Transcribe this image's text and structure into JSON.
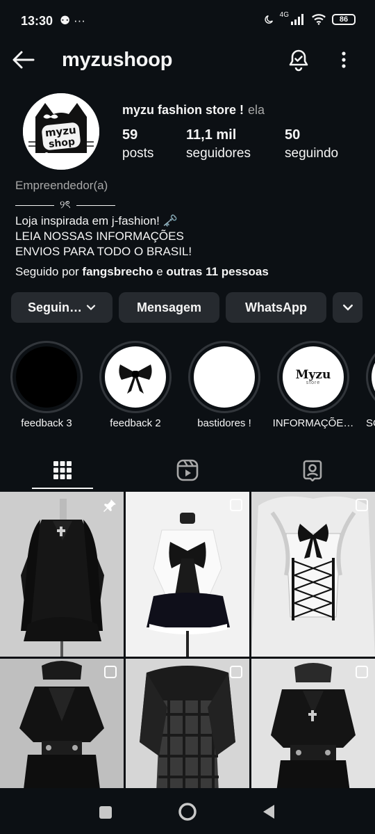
{
  "status_bar": {
    "time": "13:30",
    "left_icons": "⚉ ···",
    "network": "4G",
    "battery": "86"
  },
  "header": {
    "username": "myzushoop"
  },
  "profile": {
    "display_name": "myzu fashion store !",
    "pronouns": "ela",
    "stats": [
      {
        "value": "59",
        "label": "posts"
      },
      {
        "value": "11,1 mil",
        "label": "seguidores"
      },
      {
        "value": "50",
        "label": "seguindo"
      }
    ],
    "category": "Empreendedor(a)",
    "bio_ornament": "୨ৎ",
    "bio_lines": [
      "Loja inspirada em j-fashion! 🗝️",
      "LEIA NOSSAS INFORMAÇÕES",
      "ENVIOS PARA TODO O BRASIL!"
    ],
    "followed_by_prefix": "Seguido por",
    "followed_by_user": "fangsbrecho",
    "followed_by_and": "e",
    "followed_by_others": "outras 11 pessoas",
    "avatar_text_line1": "myzu",
    "avatar_text_line2": "shop"
  },
  "actions": {
    "following_label": "Seguin…",
    "message_label": "Mensagem",
    "whatsapp_label": "WhatsApp"
  },
  "highlights": [
    {
      "label": "feedback 3"
    },
    {
      "label": "feedback 2"
    },
    {
      "label": "bastidores !"
    },
    {
      "label": "INFORMAÇÕE…",
      "cover_text": "Myzu",
      "cover_subtext": "store"
    },
    {
      "label": "SO"
    }
  ],
  "tabs": [
    {
      "icon": "grid-icon",
      "active": true
    },
    {
      "icon": "reels-icon",
      "active": false
    },
    {
      "icon": "tagged-icon",
      "active": false
    }
  ],
  "posts": [
    {
      "pinned": true,
      "style": "black gothic blouse with cross on mannequin, light grey background"
    },
    {
      "pinned": false,
      "style": "white blouse with black bow and black frilled skirt"
    },
    {
      "pinned": false,
      "style": "white lace corset with black lacing and bow"
    },
    {
      "pinned": false,
      "style": "black blouse with beret and double belt"
    },
    {
      "pinned": false,
      "style": "black lace bolero over plaid dress"
    },
    {
      "pinned": false,
      "style": "black ruffled jacket with cap and belts"
    }
  ],
  "colors": {
    "background": "#0c1014",
    "button": "#262a2f",
    "muted_text": "#a8a8a8",
    "text": "#f5f5f5"
  }
}
